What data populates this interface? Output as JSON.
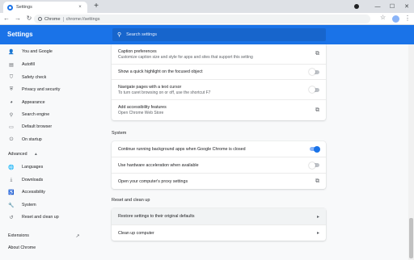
{
  "browser": {
    "tab_title": "Settings",
    "tab_close": "×",
    "new_tab": "+",
    "chip_label": "Chrome",
    "url": "chrome://settings"
  },
  "header": {
    "title": "Settings",
    "search_placeholder": "Search settings"
  },
  "sidebar": {
    "items": [
      {
        "label": "You and Google",
        "icon": "person-icon"
      },
      {
        "label": "Autofill",
        "icon": "clipboard-icon"
      },
      {
        "label": "Safety check",
        "icon": "shield-icon"
      },
      {
        "label": "Privacy and security",
        "icon": "shield-lock-icon"
      },
      {
        "label": "Appearance",
        "icon": "palette-icon"
      },
      {
        "label": "Search engine",
        "icon": "search-icon"
      },
      {
        "label": "Default browser",
        "icon": "browser-icon"
      },
      {
        "label": "On startup",
        "icon": "power-icon"
      }
    ],
    "advanced_label": "Advanced",
    "advanced_items": [
      {
        "label": "Languages",
        "icon": "globe-icon"
      },
      {
        "label": "Downloads",
        "icon": "download-icon"
      },
      {
        "label": "Accessibility",
        "icon": "accessibility-icon"
      },
      {
        "label": "System",
        "icon": "wrench-icon"
      },
      {
        "label": "Reset and clean up",
        "icon": "history-icon"
      }
    ],
    "extensions_label": "Extensions",
    "about_label": "About Chrome"
  },
  "accessibility_card": {
    "captions_title": "Caption preferences",
    "captions_sub": "Customize caption size and style for apps and sites that support this setting",
    "highlight_label": "Show a quick highlight on the focused object",
    "highlight_on": false,
    "caret_title": "Navigate pages with a text cursor",
    "caret_sub": "To turn caret browsing on or off, use the shortcut F7",
    "caret_on": false,
    "features_title": "Add accessibility features",
    "features_sub": "Open Chrome Web Store"
  },
  "system": {
    "section_title": "System",
    "background_label": "Continue running background apps when Google Chrome is closed",
    "background_on": true,
    "hw_label": "Use hardware acceleration when available",
    "hw_on": false,
    "proxy_label": "Open your computer's proxy settings"
  },
  "reset": {
    "section_title": "Reset and clean up",
    "restore_label": "Restore settings to their original defaults",
    "cleanup_label": "Clean up computer"
  },
  "colors": {
    "accent": "#1a73e8",
    "header_bg": "#1a73e8"
  }
}
